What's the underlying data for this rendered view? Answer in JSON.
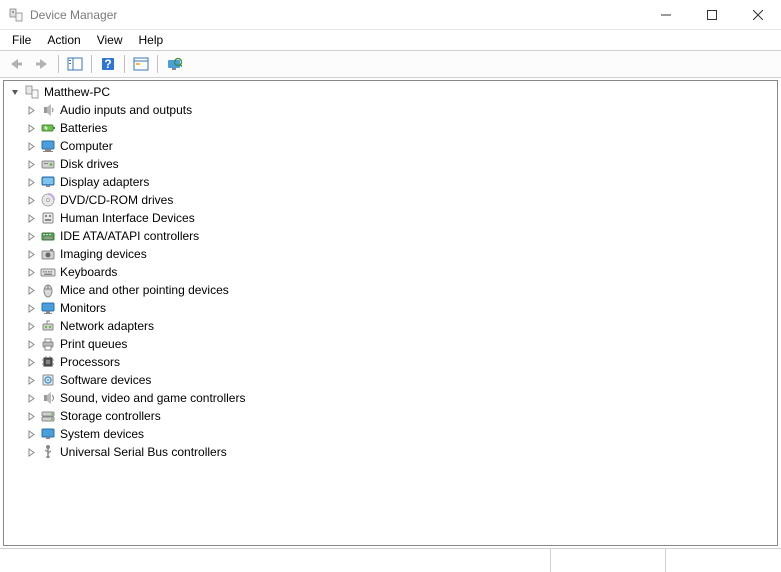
{
  "window": {
    "title": "Device Manager"
  },
  "menu": {
    "items": [
      "File",
      "Action",
      "View",
      "Help"
    ]
  },
  "tree": {
    "root": {
      "label": "Matthew-PC",
      "expanded": true
    },
    "devices": [
      {
        "label": "Audio inputs and outputs",
        "icon": "speaker"
      },
      {
        "label": "Batteries",
        "icon": "battery"
      },
      {
        "label": "Computer",
        "icon": "computer"
      },
      {
        "label": "Disk drives",
        "icon": "disk"
      },
      {
        "label": "Display adapters",
        "icon": "display"
      },
      {
        "label": "DVD/CD-ROM drives",
        "icon": "cd"
      },
      {
        "label": "Human Interface Devices",
        "icon": "hid"
      },
      {
        "label": "IDE ATA/ATAPI controllers",
        "icon": "ide"
      },
      {
        "label": "Imaging devices",
        "icon": "imaging"
      },
      {
        "label": "Keyboards",
        "icon": "keyboard"
      },
      {
        "label": "Mice and other pointing devices",
        "icon": "mouse"
      },
      {
        "label": "Monitors",
        "icon": "monitor"
      },
      {
        "label": "Network adapters",
        "icon": "network"
      },
      {
        "label": "Print queues",
        "icon": "printer"
      },
      {
        "label": "Processors",
        "icon": "cpu"
      },
      {
        "label": "Software devices",
        "icon": "software"
      },
      {
        "label": "Sound, video and game controllers",
        "icon": "sound"
      },
      {
        "label": "Storage controllers",
        "icon": "storage"
      },
      {
        "label": "System devices",
        "icon": "system"
      },
      {
        "label": "Universal Serial Bus controllers",
        "icon": "usb"
      }
    ]
  }
}
